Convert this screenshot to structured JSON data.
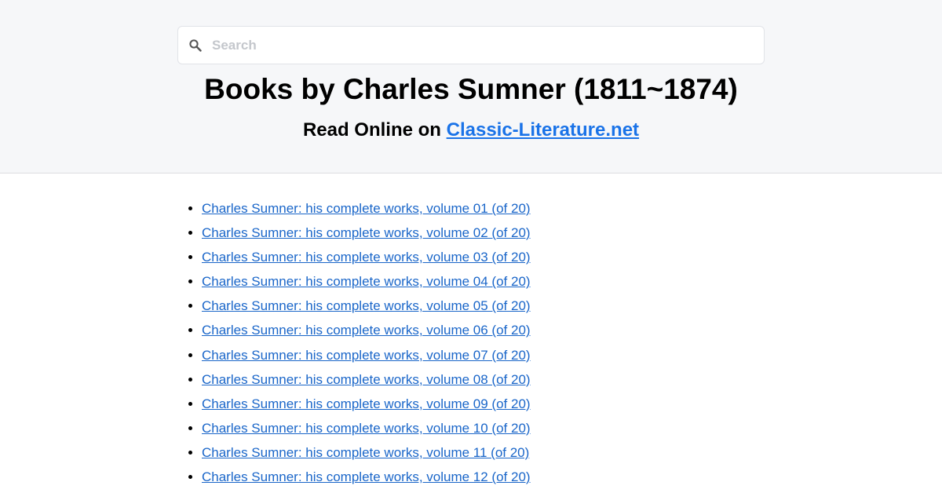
{
  "search": {
    "placeholder": "Search",
    "icon": "search-icon"
  },
  "header": {
    "title": "Books by Charles Sumner (1811~1874)",
    "subtitle_prefix": "Read Online on ",
    "subtitle_link": "Classic-Literature.net"
  },
  "colors": {
    "link": "#1a66c9",
    "header_bg": "#f6f7f9"
  },
  "books": [
    "Charles Sumner: his complete works, volume 01 (of 20)",
    "Charles Sumner: his complete works, volume 02 (of 20)",
    "Charles Sumner: his complete works, volume 03 (of 20)",
    "Charles Sumner: his complete works, volume 04 (of 20)",
    "Charles Sumner: his complete works, volume 05 (of 20)",
    "Charles Sumner: his complete works, volume 06 (of 20)",
    "Charles Sumner: his complete works, volume 07 (of 20)",
    "Charles Sumner: his complete works, volume 08 (of 20)",
    "Charles Sumner: his complete works, volume 09 (of 20)",
    "Charles Sumner: his complete works, volume 10 (of 20)",
    "Charles Sumner: his complete works, volume 11 (of 20)",
    "Charles Sumner: his complete works, volume 12 (of 20)"
  ]
}
